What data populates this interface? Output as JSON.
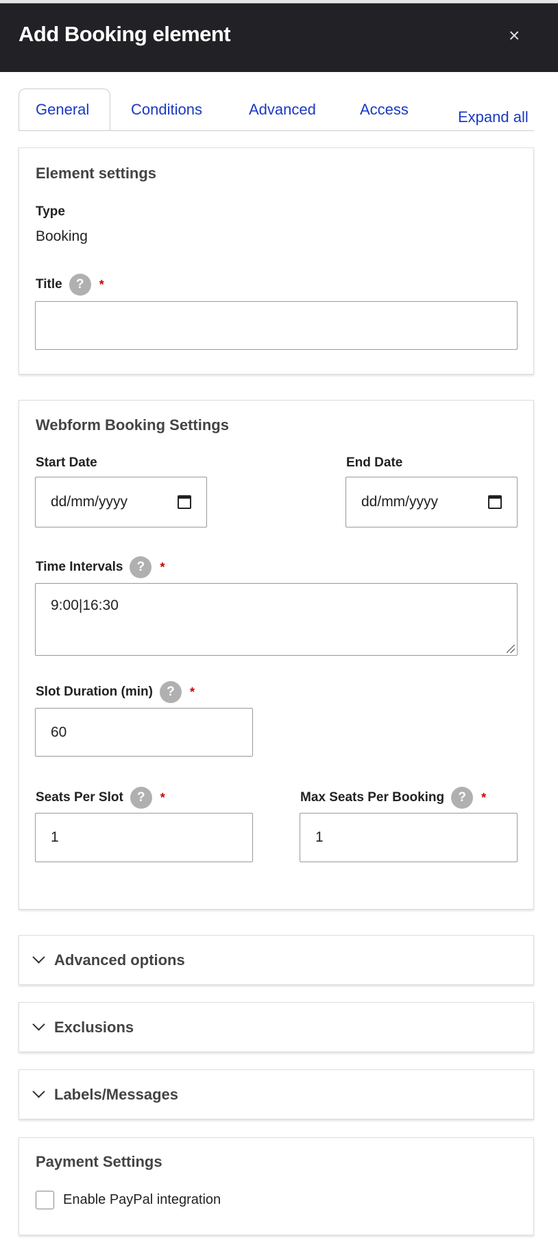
{
  "dialog": {
    "title": "Add Booking element",
    "close_label": "×"
  },
  "tabs": [
    {
      "label": "General",
      "active": true
    },
    {
      "label": "Conditions"
    },
    {
      "label": "Advanced"
    },
    {
      "label": "Access"
    }
  ],
  "expand_all": "Expand all",
  "element_settings": {
    "heading": "Element settings",
    "type_label": "Type",
    "type_value": "Booking",
    "title_label": "Title",
    "title_value": ""
  },
  "booking": {
    "heading": "Webform Booking Settings",
    "start_label": "Start Date",
    "start_placeholder": "dd/mm/yyyy",
    "end_label": "End Date",
    "end_placeholder": "dd/mm/yyyy",
    "intervals_label": "Time Intervals",
    "intervals_value": "9:00|16:30",
    "slot_label": "Slot Duration (min)",
    "slot_value": "60",
    "seats_label": "Seats Per Slot",
    "seats_value": "1",
    "max_label": "Max Seats Per Booking",
    "max_value": "1"
  },
  "help": "?",
  "required": "*",
  "collapsibles": [
    "Advanced options",
    "Exclusions",
    "Labels/Messages"
  ],
  "payment": {
    "heading": "Payment Settings",
    "paypal_label": "Enable PayPal integration",
    "paypal_checked": false
  }
}
